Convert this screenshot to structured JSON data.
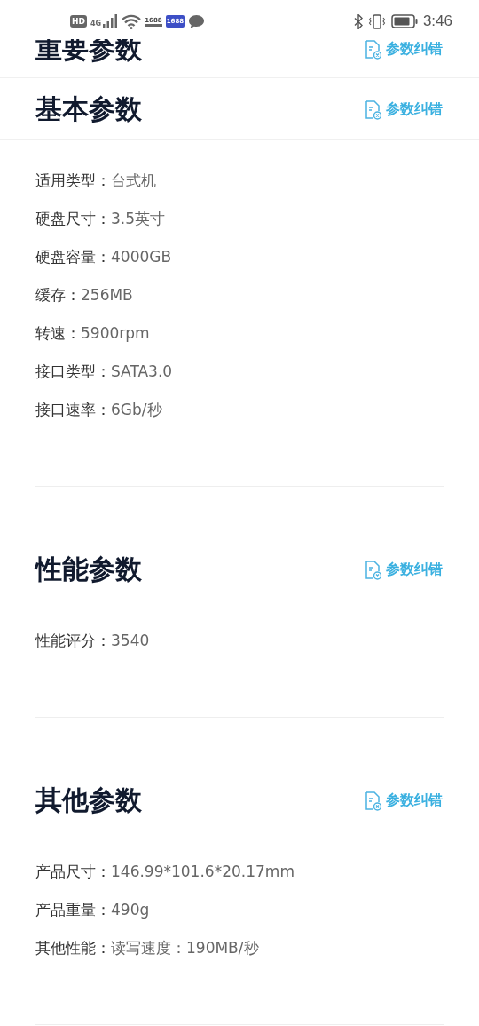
{
  "status_bar": {
    "hd_badge": "HD",
    "network": "4G",
    "app_badges": [
      "1688",
      "1688"
    ],
    "time": "3:46"
  },
  "collapsed_header": {
    "title": "重要参数",
    "link": "参数纠错"
  },
  "sections": [
    {
      "title": "基本参数",
      "link": "参数纠错",
      "header_rule": true,
      "rows": [
        {
          "label": "适用类型：",
          "value": "台式机"
        },
        {
          "label": "硬盘尺寸：",
          "value": "3.5英寸"
        },
        {
          "label": "硬盘容量：",
          "value": "4000GB"
        },
        {
          "label": "缓存：",
          "value": "256MB"
        },
        {
          "label": "转速：",
          "value": "5900rpm"
        },
        {
          "label": "接口类型：",
          "value": "SATA3.0"
        },
        {
          "label": "接口速率：",
          "value": "6Gb/秒"
        }
      ]
    },
    {
      "title": "性能参数",
      "link": "参数纠错",
      "header_rule": false,
      "rows": [
        {
          "label": "性能评分：",
          "value": "3540"
        }
      ]
    },
    {
      "title": "其他参数",
      "link": "参数纠错",
      "header_rule": false,
      "rows": [
        {
          "label": "产品尺寸：",
          "value": "146.99*101.6*20.17mm"
        },
        {
          "label": "产品重量：",
          "value": "490g"
        },
        {
          "label": "其他性能：",
          "value": "读写速度：190MB/秒"
        }
      ]
    }
  ]
}
